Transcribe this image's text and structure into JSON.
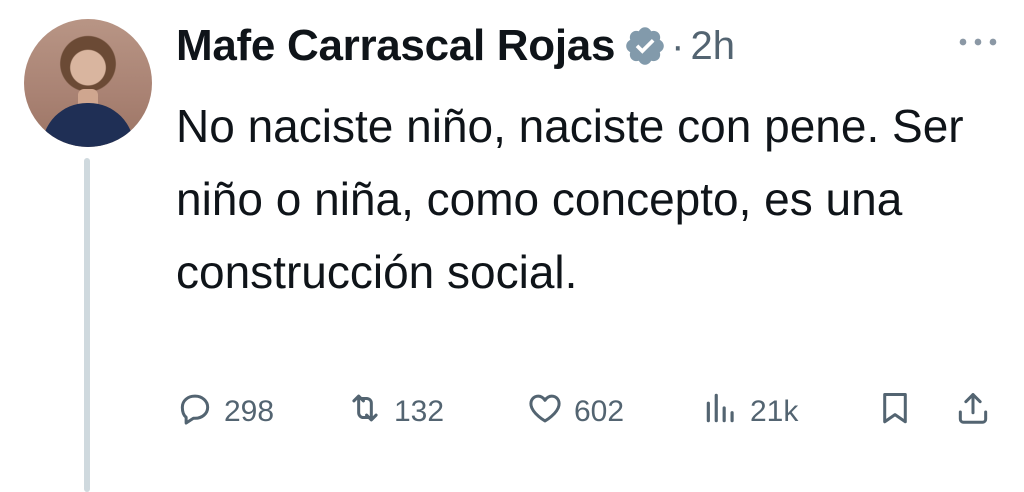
{
  "author": {
    "display_name": "Mafe Carrascal Rojas",
    "verified_icon": "verified-badge-icon",
    "separator": "·",
    "time_ago": "2h",
    "avatar_icon": "profile-photo"
  },
  "tweet": {
    "text": "No naciste niño, naciste con pene. Ser niño o niña, como concepto, es una construcción social."
  },
  "actions": {
    "reply_count": "298",
    "retweet_count": "132",
    "like_count": "602",
    "views_count": "21k"
  },
  "colors": {
    "text_primary": "#0f1419",
    "text_secondary": "#536471",
    "thread_line": "#cfd9de",
    "badge_gray": "#829aab"
  }
}
